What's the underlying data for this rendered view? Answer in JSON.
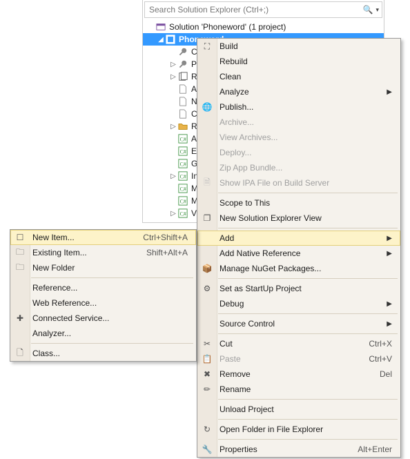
{
  "search": {
    "placeholder": "Search Solution Explorer (Ctrl+;)"
  },
  "tree": {
    "solution": "Solution 'Phoneword' (1 project)",
    "project": "Phoneword",
    "items": [
      "Co",
      "Pr",
      "Re",
      "As",
      "Na",
      "Co",
      "Re",
      "Ap",
      "En",
      "Ge",
      "In",
      "M",
      "M",
      "Vi"
    ]
  },
  "menu_main": [
    {
      "type": "item",
      "name": "build",
      "label": "Build",
      "icon": "build-icon"
    },
    {
      "type": "item",
      "name": "rebuild",
      "label": "Rebuild"
    },
    {
      "type": "item",
      "name": "clean",
      "label": "Clean"
    },
    {
      "type": "item",
      "name": "analyze",
      "label": "Analyze",
      "submenu": true
    },
    {
      "type": "item",
      "name": "publish",
      "label": "Publish...",
      "icon": "globe-icon"
    },
    {
      "type": "item",
      "name": "archive",
      "label": "Archive...",
      "disabled": true
    },
    {
      "type": "item",
      "name": "view-archives",
      "label": "View Archives...",
      "disabled": true
    },
    {
      "type": "item",
      "name": "deploy",
      "label": "Deploy...",
      "disabled": true
    },
    {
      "type": "item",
      "name": "zip-app-bundle",
      "label": "Zip App Bundle...",
      "disabled": true
    },
    {
      "type": "item",
      "name": "show-ipa",
      "label": "Show IPA File on Build Server",
      "icon": "doc-icon",
      "disabled": true
    },
    {
      "type": "sep"
    },
    {
      "type": "item",
      "name": "scope-to-this",
      "label": "Scope to This"
    },
    {
      "type": "item",
      "name": "new-se-view",
      "label": "New Solution Explorer View",
      "icon": "window-icon"
    },
    {
      "type": "sep"
    },
    {
      "type": "item",
      "name": "add",
      "label": "Add",
      "submenu": true,
      "hl": true
    },
    {
      "type": "item",
      "name": "add-native-ref",
      "label": "Add Native Reference",
      "submenu": true
    },
    {
      "type": "item",
      "name": "manage-nuget",
      "label": "Manage NuGet Packages...",
      "icon": "nuget-icon"
    },
    {
      "type": "sep"
    },
    {
      "type": "item",
      "name": "set-startup",
      "label": "Set as StartUp Project",
      "icon": "gear-icon"
    },
    {
      "type": "item",
      "name": "debug",
      "label": "Debug",
      "submenu": true
    },
    {
      "type": "sep"
    },
    {
      "type": "item",
      "name": "source-control",
      "label": "Source Control",
      "submenu": true
    },
    {
      "type": "sep"
    },
    {
      "type": "item",
      "name": "cut",
      "label": "Cut",
      "icon": "cut-icon",
      "shortcut": "Ctrl+X"
    },
    {
      "type": "item",
      "name": "paste",
      "label": "Paste",
      "icon": "paste-icon",
      "shortcut": "Ctrl+V",
      "disabled": true
    },
    {
      "type": "item",
      "name": "remove",
      "label": "Remove",
      "icon": "remove-icon",
      "shortcut": "Del"
    },
    {
      "type": "item",
      "name": "rename",
      "label": "Rename",
      "icon": "rename-icon"
    },
    {
      "type": "sep"
    },
    {
      "type": "item",
      "name": "unload-project",
      "label": "Unload Project"
    },
    {
      "type": "sep"
    },
    {
      "type": "item",
      "name": "open-folder",
      "label": "Open Folder in File Explorer",
      "icon": "open-folder-icon"
    },
    {
      "type": "sep"
    },
    {
      "type": "item",
      "name": "properties",
      "label": "Properties",
      "icon": "wrench-icon",
      "shortcut": "Alt+Enter"
    }
  ],
  "menu_add": [
    {
      "type": "item",
      "name": "new-item",
      "label": "New Item...",
      "icon": "new-item-icon",
      "shortcut": "Ctrl+Shift+A",
      "hl": true
    },
    {
      "type": "item",
      "name": "existing-item",
      "label": "Existing Item...",
      "icon": "existing-icon",
      "shortcut": "Shift+Alt+A"
    },
    {
      "type": "item",
      "name": "new-folder",
      "label": "New Folder",
      "icon": "new-folder-icon"
    },
    {
      "type": "sep"
    },
    {
      "type": "item",
      "name": "reference",
      "label": "Reference..."
    },
    {
      "type": "item",
      "name": "web-reference",
      "label": "Web Reference..."
    },
    {
      "type": "item",
      "name": "connected-svc",
      "label": "Connected Service...",
      "icon": "connected-icon"
    },
    {
      "type": "item",
      "name": "analyzer",
      "label": "Analyzer..."
    },
    {
      "type": "sep"
    },
    {
      "type": "item",
      "name": "class",
      "label": "Class...",
      "icon": "class-icon"
    }
  ],
  "icons": {
    "build-icon": "⛶",
    "globe-icon": "🌐",
    "doc-icon": "🗎",
    "window-icon": "❐",
    "nuget-icon": "📦",
    "gear-icon": "⚙",
    "cut-icon": "✂",
    "paste-icon": "📋",
    "remove-icon": "✖",
    "rename-icon": "✏",
    "open-folder-icon": "↻",
    "wrench-icon": "🔧",
    "new-item-icon": "☐",
    "existing-icon": "🗀",
    "new-folder-icon": "🗀",
    "connected-icon": "✚",
    "class-icon": "🗋",
    "cs-icon": "C#"
  }
}
